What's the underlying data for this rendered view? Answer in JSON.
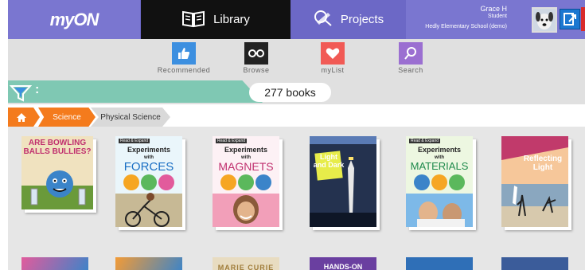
{
  "header": {
    "logo": "myON",
    "tabs": [
      {
        "label": "Library",
        "icon": "book-icon",
        "active": true
      },
      {
        "label": "Projects",
        "icon": "projects-icon",
        "active": false
      }
    ],
    "user": {
      "name": "Grace H",
      "role": "Student",
      "school": "Hedly Elementary School (demo)"
    }
  },
  "nav": {
    "items": [
      {
        "label": "Recommended",
        "icon": "thumbs-up-icon",
        "color": "#3c8fe0"
      },
      {
        "label": "Browse",
        "icon": "glasses-icon",
        "color": "#222222"
      },
      {
        "label": "myList",
        "icon": "heart-icon",
        "color": "#f15a55"
      },
      {
        "label": "Search",
        "icon": "search-icon",
        "color": "#9b6fd1"
      }
    ]
  },
  "filter": {
    "colon": ":",
    "count": "277 books"
  },
  "breadcrumb": {
    "items": [
      "Science",
      "Physical Science"
    ]
  },
  "books": [
    {
      "title": "ARE BOWLING BALLS BULLIES?",
      "badge": "",
      "top": "",
      "main": ""
    },
    {
      "title": "FORCES",
      "badge": "Read & Expand",
      "top": "Experiments",
      "sub": "with"
    },
    {
      "title": "MAGNETS",
      "badge": "Read & Expand",
      "top": "Experiments",
      "sub": "with"
    },
    {
      "title": "Light and Dark",
      "badge": "",
      "top": "",
      "sub": ""
    },
    {
      "title": "MATERIALS",
      "badge": "Read & Expand",
      "top": "Experiments",
      "sub": "with"
    },
    {
      "title": "Reflecting Light",
      "badge": "",
      "top": "",
      "sub": ""
    }
  ],
  "books_row2": [
    {
      "title": ""
    },
    {
      "title": ""
    },
    {
      "title": "MARIE CURIE"
    },
    {
      "title": "HANDS-ON"
    },
    {
      "title": ""
    },
    {
      "title": ""
    }
  ],
  "colors": {
    "topbar": "#6c68c6",
    "active_tab": "#111111",
    "filter_teal": "#7fc8b3",
    "breadcrumb_orange": "#f47b1d"
  }
}
